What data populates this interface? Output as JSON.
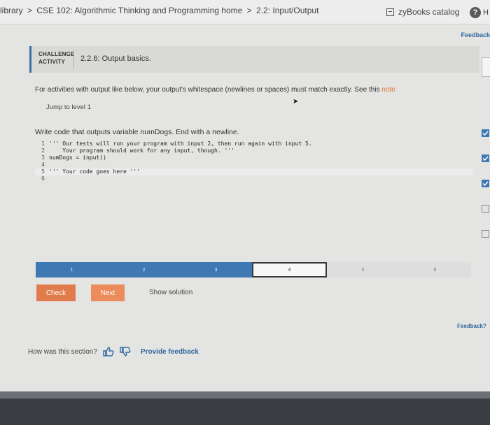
{
  "breadcrumb": [
    "library",
    ">",
    "CSE 102: Algorithmic Thinking and Programming home",
    ">",
    "2.2: Input/Output"
  ],
  "catalog_label": "zyBooks catalog",
  "help_label": "H",
  "feedback_top": "Feedback",
  "activity": {
    "type_line1": "CHALLENGE",
    "type_line2": "ACTIVITY",
    "title": "2.2.6: Output basics."
  },
  "instructions_prefix": "For activities with output like below, your output's whitespace (newlines or spaces) must match exactly. See this",
  "instructions_link": "note",
  "jump_label": "Jump to level 1",
  "task": "Write code that outputs variable numDogs. End with a newline.",
  "code": [
    {
      "n": "1",
      "text": "''' Our tests will run your program with input 2, then run again with input 5."
    },
    {
      "n": "2",
      "text": "    Your program should work for any input, though. '''"
    },
    {
      "n": "3",
      "text": "numDogs = input()"
    },
    {
      "n": "4",
      "text": ""
    },
    {
      "n": "5",
      "text": "''' Your code goes here '''"
    },
    {
      "n": "6",
      "text": ""
    }
  ],
  "levels": [
    "1",
    "2",
    "3",
    "4",
    "5",
    "6"
  ],
  "current_level": "4",
  "buttons": {
    "check": "Check",
    "next": "Next",
    "show_solution": "Show solution"
  },
  "feedback_mid": "Feedback?",
  "rate_question": "How was this section?",
  "provide_feedback": "Provide feedback",
  "colors": {
    "accent": "#3f79b4",
    "check_button": "#e07c4c",
    "next_button": "#ec8c5a",
    "link": "#2f6aa0"
  }
}
